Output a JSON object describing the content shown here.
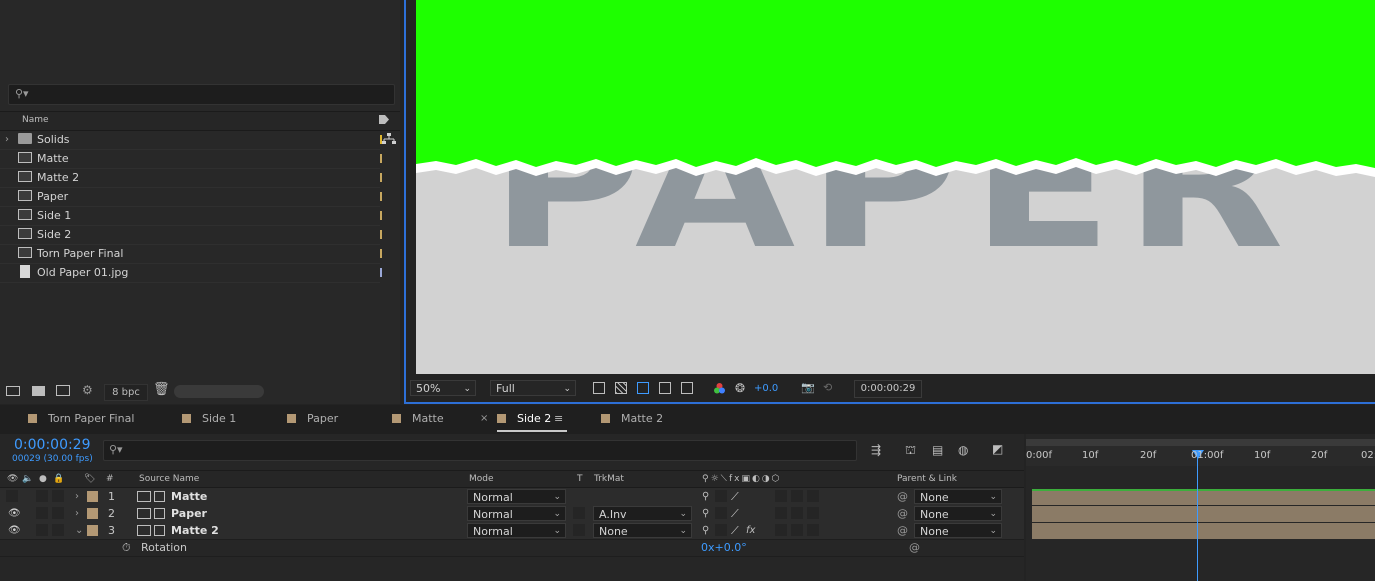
{
  "project": {
    "columns": {
      "name": "Name"
    },
    "items": [
      {
        "label": "Solids",
        "icon": "folder-icon"
      },
      {
        "label": "Matte",
        "icon": "comp-icon"
      },
      {
        "label": "Matte 2",
        "icon": "comp-icon"
      },
      {
        "label": "Paper",
        "icon": "comp-icon"
      },
      {
        "label": "Side 1",
        "icon": "comp-icon"
      },
      {
        "label": "Side 2",
        "icon": "comp-icon"
      },
      {
        "label": "Torn Paper Final",
        "icon": "comp-icon"
      },
      {
        "label": "Old Paper 01.jpg",
        "icon": "image-file-icon"
      }
    ],
    "footer": {
      "bpc": "8 bpc"
    }
  },
  "viewer": {
    "canvas_text": "PAPER",
    "zoom": "50%",
    "resolution": "Full",
    "exposure": "+0.0",
    "timecode": "0:00:00:29",
    "colors": {
      "green_screen": "#1eff00",
      "paper": "#d2d2d2",
      "text": "#8f979d"
    }
  },
  "tabs": [
    {
      "label": "Torn Paper Final"
    },
    {
      "label": "Side 1"
    },
    {
      "label": "Paper"
    },
    {
      "label": "Matte"
    },
    {
      "label": "Side 2",
      "active": true
    },
    {
      "label": "Matte 2"
    }
  ],
  "timeline": {
    "current_time": "0:00:00:29",
    "frame_info": "00029 (30.00 fps)",
    "columns": {
      "number": "#",
      "source_name": "Source Name",
      "mode": "Mode",
      "t": "T",
      "trkmat": "TrkMat",
      "parent": "Parent & Link"
    },
    "layers": [
      {
        "num": "1",
        "name": "Matte",
        "mode": "Normal",
        "trkmat": "",
        "parent": "None"
      },
      {
        "num": "2",
        "name": "Paper",
        "mode": "Normal",
        "trkmat": "A.Inv",
        "parent": "None"
      },
      {
        "num": "3",
        "name": "Matte 2",
        "mode": "Normal",
        "trkmat": "None",
        "parent": "None"
      }
    ],
    "property": {
      "name": "Rotation",
      "value": "0x+0.0°"
    },
    "ruler": [
      "0:00f",
      "10f",
      "20f",
      "01:00f",
      "10f",
      "20f",
      "02:"
    ]
  }
}
